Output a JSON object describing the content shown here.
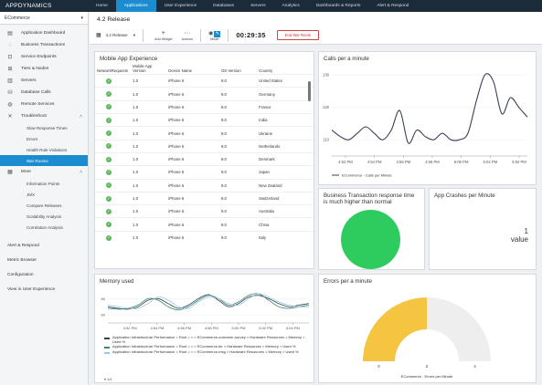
{
  "brand": {
    "name_bold": "APP",
    "name_rest": "DYNAMICS"
  },
  "nav": [
    "Home",
    "Applications",
    "User Experience",
    "Databases",
    "Servers",
    "Analytics",
    "Dashboards & Reports",
    "Alert & Respond"
  ],
  "sidebar": {
    "app": "ECommerce",
    "items": [
      {
        "label": "Application Dashboard",
        "icon": "dashboard-icon"
      },
      {
        "label": "Business Transactions",
        "icon": "transactions-icon"
      },
      {
        "label": "Service Endpoints",
        "icon": "endpoint-icon"
      },
      {
        "label": "Tiers & Nodes",
        "icon": "tiers-icon"
      },
      {
        "label": "Servers",
        "icon": "server-icon"
      },
      {
        "label": "Database Calls",
        "icon": "database-icon"
      },
      {
        "label": "Remote Services",
        "icon": "remote-icon"
      },
      {
        "label": "Troubleshoot",
        "icon": "wrench-icon"
      }
    ],
    "troubleshoot_sub": [
      "Slow Response Times",
      "Errors",
      "Health Rule Violations",
      "War Rooms"
    ],
    "more": "More",
    "more_sub": [
      "Information Points",
      "JMX",
      "Compare Releases",
      "Scalability Analysis",
      "Correlation Analysis"
    ],
    "bottom": [
      "Alert & Respond",
      "Metric Browser",
      "Configuration",
      "View in User Experience"
    ]
  },
  "page": {
    "title": "4.2 Release"
  },
  "toolbar": {
    "release": "4.2 Release",
    "add_widget": "Add Widget",
    "actions": "Actions",
    "mode": "Mode",
    "timer": "00:29:35",
    "end": "End War Room"
  },
  "mobile": {
    "title": "Mobile App Experience",
    "headers": [
      "NetworkRequests",
      "Mobile App Version",
      "Device Name",
      "OS Version",
      "Country"
    ],
    "rows": [
      [
        "1.0",
        "iPhone 6",
        "9.0",
        "United States"
      ],
      [
        "1.0",
        "iPhone 6",
        "9.0",
        "Germany"
      ],
      [
        "1.0",
        "iPhone 6",
        "9.0",
        "France"
      ],
      [
        "1.0",
        "iPhone 6",
        "9.0",
        "India"
      ],
      [
        "1.0",
        "iPhone 6",
        "9.0",
        "Ukraine"
      ],
      [
        "1.0",
        "iPhone 6",
        "9.0",
        "Netherlands"
      ],
      [
        "1.0",
        "iPhone 6",
        "9.0",
        "Denmark"
      ],
      [
        "1.0",
        "iPhone 6",
        "9.0",
        "Japan"
      ],
      [
        "1.0",
        "iPhone 6",
        "9.0",
        "New Zealand"
      ],
      [
        "1.0",
        "iPhone 6",
        "9.0",
        "Switzerland"
      ],
      [
        "1.0",
        "iPhone 6",
        "9.0",
        "Australia"
      ],
      [
        "1.0",
        "iPhone 6",
        "9.0",
        "China"
      ],
      [
        "1.0",
        "iPhone 6",
        "9.0",
        "Italy"
      ]
    ]
  },
  "widgets": {
    "health_title": "Business Transaction response time is much higher than normal",
    "crashes_title": "App Crashes per Minute",
    "crashes_value": "1",
    "crashes_unit": "value",
    "memory_legend": [
      "Application Infrastructure Performance > Root > > > ECommerce-customer-survey > Hardware Resources > Memory > Used %",
      "Application Infrastructure Performance > Root > > > ECommerce-lbr > Hardware Resources > Memory > Used %",
      "Application Infrastructure Performance > Root > > > ECommerce-msg > Hardware Resources > Memory > Used %"
    ],
    "memory_pager": "1/4"
  },
  "chart_data": [
    {
      "type": "line",
      "title": "Calls per a minute",
      "ylim": [
        105,
        132
      ],
      "yticks": [
        110,
        120,
        130
      ],
      "xticks": [
        "4:52 PM",
        "4:54 PM",
        "4:56 PM",
        "4:58 PM",
        "5:00 PM",
        "5:02 PM",
        "5:04 PM"
      ],
      "series": [
        {
          "name": "ECommerce - Calls per Minute",
          "color": "#3a3f55",
          "x": [
            0,
            1,
            2,
            3,
            4,
            5,
            6,
            7,
            8,
            9,
            10,
            11,
            12,
            13,
            14,
            15,
            16,
            17,
            18,
            19,
            20,
            21,
            22,
            23
          ],
          "y": [
            113,
            111,
            110,
            112,
            114,
            112,
            110,
            113,
            119,
            109,
            113,
            111,
            110,
            112,
            110,
            110,
            112,
            122,
            130,
            128,
            118,
            123,
            120,
            117
          ]
        }
      ]
    },
    {
      "type": "line",
      "title": "Memory used",
      "ylim": [
        50,
        95
      ],
      "yticks": [
        60,
        80
      ],
      "xticks": [
        "4:52 PM",
        "4:54 PM",
        "4:56 PM",
        "4:58 PM",
        "5:00 PM",
        "5:02 PM",
        "5:04 PM"
      ],
      "series": [
        {
          "color": "#3a3f55",
          "x": [
            0,
            1,
            2,
            3,
            4,
            5,
            6,
            7,
            8,
            9,
            10,
            11,
            12,
            13,
            14,
            15,
            16,
            17,
            18,
            19,
            20
          ],
          "y": [
            70,
            68,
            67,
            70,
            78,
            80,
            74,
            68,
            72,
            80,
            85,
            78,
            70,
            74,
            82,
            84,
            80,
            74,
            70,
            72,
            74
          ]
        },
        {
          "color": "#3a8a6a",
          "x": [
            0,
            1,
            2,
            3,
            4,
            5,
            6,
            7,
            8,
            9,
            10,
            11,
            12,
            13,
            14,
            15,
            16,
            17,
            18,
            19,
            20
          ],
          "y": [
            68,
            67,
            68,
            72,
            80,
            78,
            70,
            66,
            70,
            78,
            84,
            80,
            72,
            76,
            84,
            86,
            78,
            70,
            68,
            70,
            72
          ]
        },
        {
          "color": "#9ac8e8",
          "x": [
            0,
            1,
            2,
            3,
            4,
            5,
            6,
            7,
            8,
            9,
            10,
            11,
            12,
            13,
            14,
            15,
            16,
            17,
            18,
            19,
            20
          ],
          "y": [
            72,
            70,
            68,
            68,
            74,
            82,
            78,
            70,
            68,
            76,
            82,
            80,
            74,
            72,
            80,
            86,
            82,
            76,
            72,
            70,
            70
          ]
        }
      ]
    },
    {
      "type": "gauge",
      "title": "Errors per a minute",
      "min": 0,
      "max": 4,
      "value": 2,
      "ticks": [
        "0",
        "2",
        "4"
      ],
      "series_name": "ECommerce - Errors per Minute",
      "color": "#f5c542"
    }
  ],
  "colors": {
    "accent": "#1a8ccf",
    "ok": "#5cb85c",
    "health": "#2ecc5f",
    "gauge": "#f5c542",
    "end": "#cc3333"
  }
}
